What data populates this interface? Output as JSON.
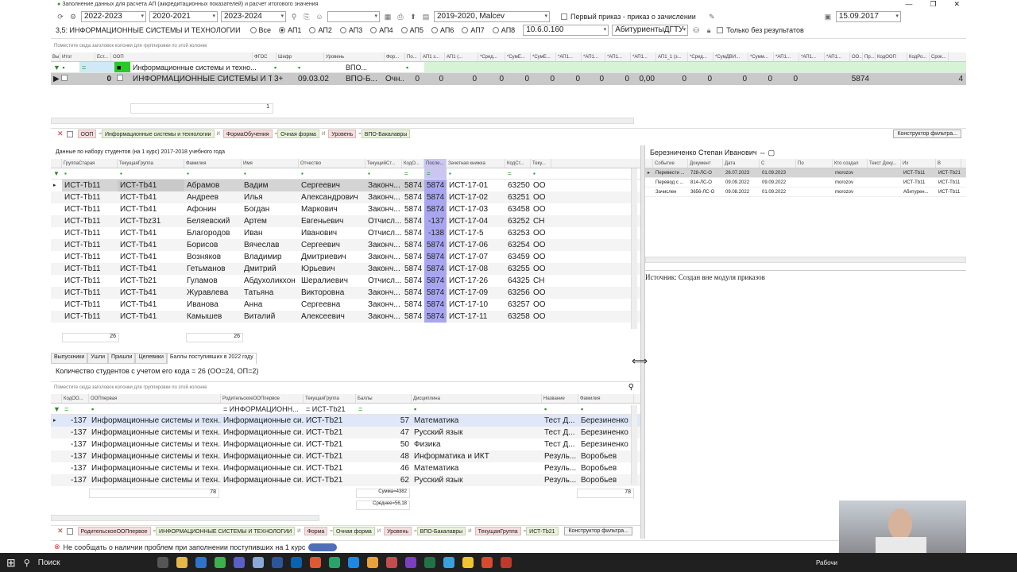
{
  "window": {
    "title": "Заполнение данных для расчета АП (аккредитационных показателей) и расчет итогового значения"
  },
  "toolbar1": {
    "year1": "2022-2023",
    "year2": "2020-2021",
    "year3": "2023-2024",
    "plan": "2019-2020, Malcev",
    "first_order_label": "Первый приказ - приказ о зачислении",
    "date": "15.09.2017"
  },
  "toolbar2": {
    "spec": "3,5: ИНФОРМАЦИОННЫЕ СИСТЕМЫ И ТЕХНОЛОГИИ",
    "radios": [
      "Все",
      "АП1",
      "АП2",
      "АП3",
      "АП4",
      "АП5",
      "АП6",
      "АП7",
      "АП8"
    ],
    "version": "10.6.0.160",
    "db": "АбитуриентыДГТУ",
    "no_results": "Только без результатов"
  },
  "top_grid": {
    "hint": "Поместите сюда заголовок колонки для группировки по этой колонке",
    "columns": [
      "Вы...",
      "Итог",
      "Ест...",
      "ООП",
      "ФГОС",
      "Шифр",
      "Уровень",
      "Фор...",
      "По...",
      "АП1 з...",
      "АП1 (...",
      "*Сред...",
      "*СумЕ...",
      "*СумЕ...",
      "*АП1...",
      "*АП1...",
      "*АП1...",
      "*АП1...",
      "АП1_1 (з...",
      "*Сред...",
      "*СумДВИ...",
      "*Сумм...",
      "*АП1...",
      "*АП1...",
      "*АП1...",
      "ОО...",
      "Пр...",
      "КодООП",
      "КодРо...",
      "Срок..."
    ],
    "filter": {
      "oop": "Информационные системы и техно...",
      "level": "ВПО..."
    },
    "row": {
      "itog": "0",
      "oop": "ИНФОРМАЦИОННЫЕ СИСТЕМЫ И ТЕ...",
      "fgos": "3+",
      "code": "09.03.02",
      "level": "ВПО-Б...",
      "form": "Очн...",
      "vals": [
        "0",
        "0",
        "0",
        "0",
        "0",
        "0",
        "0",
        "0",
        "0",
        "0,00",
        "0",
        "0",
        "0",
        "0",
        "0"
      ],
      "kodoop": "5874",
      "srok": "4"
    },
    "count": "1"
  },
  "filter_bar1": {
    "chips": [
      "ООП",
      "Информационные системы и технологии",
      "ФормаОбучения",
      "Очная форма",
      "Уровень",
      "ВПО-Бакалавры"
    ],
    "and": "И",
    "constructor": "Конструктор фильтра..."
  },
  "students": {
    "title": "Данные по набору студентов (на 1 курс) 2017-2018 учебного года",
    "columns": [
      "ГруппаСтарая",
      "ТекущаяГруппа",
      "Фамилия",
      "Имя",
      "Отчество",
      "ТекущийСт...",
      "КодО...",
      "После...",
      "Зачетная книжка",
      "КодСт...",
      "Теку..."
    ],
    "rows": [
      [
        "ИСТ-Тb11",
        "ИСТ-Тb41",
        "Абрамов",
        "Вадим",
        "Сергеевич",
        "Законч...",
        "5874",
        "5874",
        "ИСТ-17-01",
        "63250",
        "ОО"
      ],
      [
        "ИСТ-Тb11",
        "ИСТ-Тb41",
        "Андреев",
        "Илья",
        "Александрович",
        "Законч...",
        "5874",
        "5874",
        "ИСТ-17-02",
        "63251",
        "ОО"
      ],
      [
        "ИСТ-Тb11",
        "ИСТ-Тb41",
        "Афонин",
        "Богдан",
        "Маркович",
        "Законч...",
        "5874",
        "5874",
        "ИСТ-17-03",
        "63458",
        "ОО"
      ],
      [
        "ИСТ-Тb11",
        "ИСТ-Тbz31",
        "Беляевский",
        "Артем",
        "Евгеньевич",
        "Отчисл...",
        "5874",
        "-137",
        "ИСТ-17-04",
        "63252",
        "СН"
      ],
      [
        "ИСТ-Тb11",
        "ИСТ-Тb41",
        "Благородов",
        "Иван",
        "Иванович",
        "Отчисл...",
        "5874",
        "-138",
        "ИСТ-17-5",
        "63253",
        "ОО"
      ],
      [
        "ИСТ-Тb11",
        "ИСТ-Тb41",
        "Борисов",
        "Вячеслав",
        "Сергеевич",
        "Законч...",
        "5874",
        "5874",
        "ИСТ-17-06",
        "63254",
        "ОО"
      ],
      [
        "ИСТ-Тb11",
        "ИСТ-Тb41",
        "Возняков",
        "Владимир",
        "Дмитриевич",
        "Законч...",
        "5874",
        "5874",
        "ИСТ-17-07",
        "63459",
        "ОО"
      ],
      [
        "ИСТ-Тb11",
        "ИСТ-Тb41",
        "Гетьманов",
        "Дмитрий",
        "Юрьевич",
        "Законч...",
        "5874",
        "5874",
        "ИСТ-17-08",
        "63255",
        "ОО"
      ],
      [
        "ИСТ-Тb11",
        "ИСТ-Тb21",
        "Гуламов",
        "Абдухоликхон",
        "Шералиевич",
        "Отчисл...",
        "5874",
        "5874",
        "ИСТ-17-26",
        "64325",
        "СН"
      ],
      [
        "ИСТ-Тb11",
        "ИСТ-Тb41",
        "Журавлева",
        "Татьяна",
        "Викторовна",
        "Законч...",
        "5874",
        "5874",
        "ИСТ-17-09",
        "63256",
        "ОО"
      ],
      [
        "ИСТ-Тb11",
        "ИСТ-Тb41",
        "Иванова",
        "Анна",
        "Сергеевна",
        "Законч...",
        "5874",
        "5874",
        "ИСТ-17-10",
        "63257",
        "ОО"
      ],
      [
        "ИСТ-Тb11",
        "ИСТ-Тb41",
        "Камышев",
        "Виталий",
        "Алексеевич",
        "Законч...",
        "5874",
        "5874",
        "ИСТ-17-11",
        "63258",
        "ОО"
      ]
    ],
    "count_a": "26",
    "count_b": "26"
  },
  "tabs": [
    "Выпускники",
    "Ушли",
    "Пришли",
    "Целевики",
    "Баллы поступивших в 2022 году"
  ],
  "summary": "Количество студентов с учетом его кода = 26 (ОО=24, ОП=2)",
  "scores": {
    "hint": "Поместите сюда заголовок колонки для группировки по этой колонке",
    "columns": [
      "КодОО...",
      "ООПпервая",
      "РодительскоеООПпервое",
      "ТекущаяГруппа",
      "Баллы",
      "Дисциплина",
      "Название",
      "Фамилия"
    ],
    "filter": {
      "parent": "ИНФОРМАЦИОНН...",
      "group": "ИСТ-Тb21"
    },
    "rows": [
      [
        "-137",
        "Информационные системы и техн...",
        "Информационные си...",
        "ИСТ-Тb21",
        "57",
        "Математика",
        "Тест Д...",
        "Березиненко"
      ],
      [
        "-137",
        "Информационные системы и техн...",
        "Информационные си...",
        "ИСТ-Тb21",
        "47",
        "Русский язык",
        "Тест Д...",
        "Березиненко"
      ],
      [
        "-137",
        "Информационные системы и техн...",
        "Информационные си...",
        "ИСТ-Тb21",
        "50",
        "Физика",
        "Тест Д...",
        "Березиненко"
      ],
      [
        "-137",
        "Информационные системы и техн...",
        "Информационные си...",
        "ИСТ-Тb21",
        "48",
        "Информатика и ИКТ",
        "Резуль...",
        "Воробьев"
      ],
      [
        "-137",
        "Информационные системы и техн...",
        "Информационные си...",
        "ИСТ-Тb21",
        "46",
        "Математика",
        "Резуль...",
        "Воробьев"
      ],
      [
        "-137",
        "Информационные системы и техн...",
        "Информационные си...",
        "ИСТ-Тb21",
        "62",
        "Русский язык",
        "Резуль...",
        "Воробьев"
      ]
    ],
    "count_a": "78",
    "sum": "Сумма=4382",
    "avg": "Среднее=56,18",
    "count_b": "78"
  },
  "filter_bar2": {
    "chips": [
      "РодительскоеООПпервое",
      "ИНФОРМАЦИОННЫЕ СИСТЕМЫ И ТЕХНОЛОГИИ",
      "Форма",
      "Очная форма",
      "Уровень",
      "ВПО-Бакалавры",
      "ТекущаяГруппа",
      "ИСТ-Тb21"
    ],
    "and": "И",
    "constructor": "Конструктор фильтра..."
  },
  "right": {
    "person": "Березниченко Степан Иванович",
    "columns": [
      "Событие",
      "Документ",
      "Дата",
      "С",
      "По",
      "Кто создал",
      "Текст Доку...",
      "Их",
      "В"
    ],
    "rows": [
      [
        "Перевести ...",
        "728-ЛС-О",
        "26.07.2023",
        "01.09.2023",
        "",
        "morozov",
        "",
        "ИСТ-Тb11",
        "ИСТ-Тb21"
      ],
      [
        "Перевод с ...",
        "814-ЛС-О",
        "09.09.2022",
        "09.09.2022",
        "",
        "morozov",
        "",
        "ИСТ-Тb11",
        "ИСТ-Тb11"
      ],
      [
        "Зачислен",
        "3656-ЛС-О",
        "09.08.2022",
        "01.09.2022",
        "",
        "morozov",
        "",
        "Абитурен...",
        "ИСТ-Тb11"
      ]
    ],
    "source": "Источник: Создан вне модуля приказов"
  },
  "status": {
    "text": "Не сообщать о наличии проблем при заполнении поступивших на 1 курс"
  },
  "taskbar": {
    "search": "Поиск",
    "desktop": "Рабочи"
  },
  "colors": {
    "violet": "#a9a6f0",
    "selected": "#c9c9c9",
    "filter_green": "#2a8a2a",
    "chip_red": "#f6dede"
  }
}
